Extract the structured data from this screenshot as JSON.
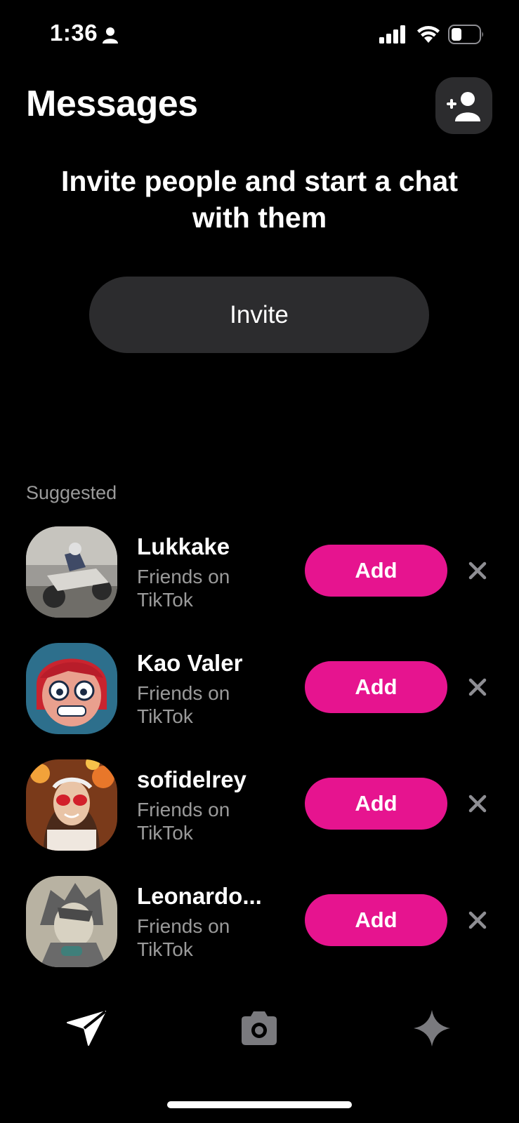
{
  "status_bar": {
    "time": "1:36",
    "icons": [
      "person-icon",
      "signal-icon",
      "wifi-icon",
      "battery-icon"
    ]
  },
  "header": {
    "title": "Messages",
    "add_friend_icon": "add-person-icon"
  },
  "invite": {
    "heading": "Invite people and start a chat with them",
    "button_label": "Invite"
  },
  "suggested": {
    "label": "Suggested",
    "items": [
      {
        "name": "Lukkake",
        "subtitle": "Friends on TikTok",
        "action": "Add"
      },
      {
        "name": "Kao Valer",
        "subtitle": "Friends on TikTok",
        "action": "Add"
      },
      {
        "name": "sofidelrey",
        "subtitle": "Friends on TikTok",
        "action": "Add"
      },
      {
        "name": "Leonardo...",
        "subtitle": "Friends on TikTok",
        "action": "Add"
      }
    ]
  },
  "bottom_nav": {
    "items": [
      "send-icon",
      "camera-icon",
      "sparkle-icon"
    ]
  },
  "colors": {
    "background": "#000000",
    "accent": "#e6148f",
    "surface": "#2c2c2e",
    "secondary_text": "#9a9a9a"
  }
}
